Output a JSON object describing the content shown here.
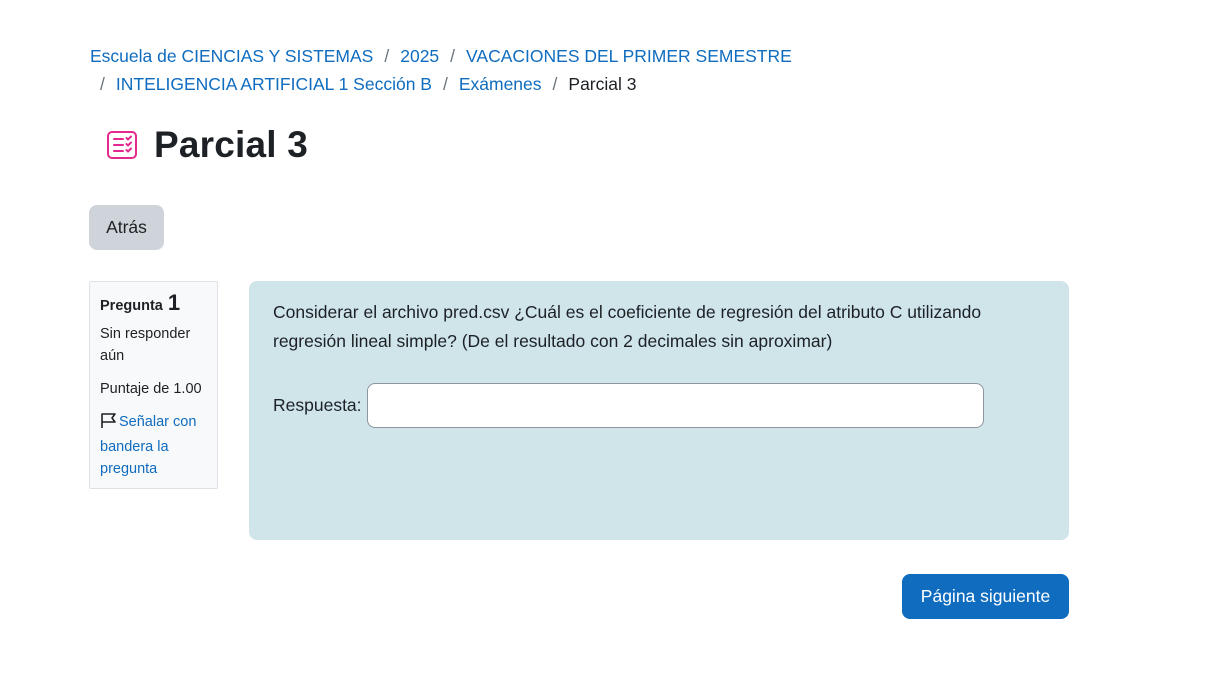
{
  "breadcrumb": {
    "items": [
      "Escuela de CIENCIAS Y SISTEMAS",
      "2025",
      "VACACIONES DEL PRIMER SEMESTRE",
      "INTELIGENCIA ARTIFICIAL 1 Sección B",
      "Exámenes"
    ],
    "current": "Parcial 3",
    "separator": "/"
  },
  "page": {
    "title": "Parcial 3",
    "icon": "quiz-icon",
    "icon_color": "#e5288f"
  },
  "navigation": {
    "back_label": "Atrás",
    "next_label": "Página siguiente"
  },
  "question_info": {
    "label": "Pregunta",
    "number": "1",
    "state": "Sin responder aún",
    "grade": "Puntaje de 1.00",
    "flag_label": "Señalar con bandera la pregunta",
    "flag_icon": "flag-icon"
  },
  "question": {
    "text": "Considerar el archivo pred.csv ¿Cuál es el coeficiente de regresión del atributo C utilizando regresión lineal simple? (De el resultado con 2 decimales sin aproximar)",
    "answer_label": "Respuesta:",
    "answer_value": ""
  },
  "colors": {
    "link": "#0f6cbf",
    "primary_button": "#0f6cbf",
    "secondary_button": "#ced4da",
    "question_background": "#cfe5ea"
  }
}
